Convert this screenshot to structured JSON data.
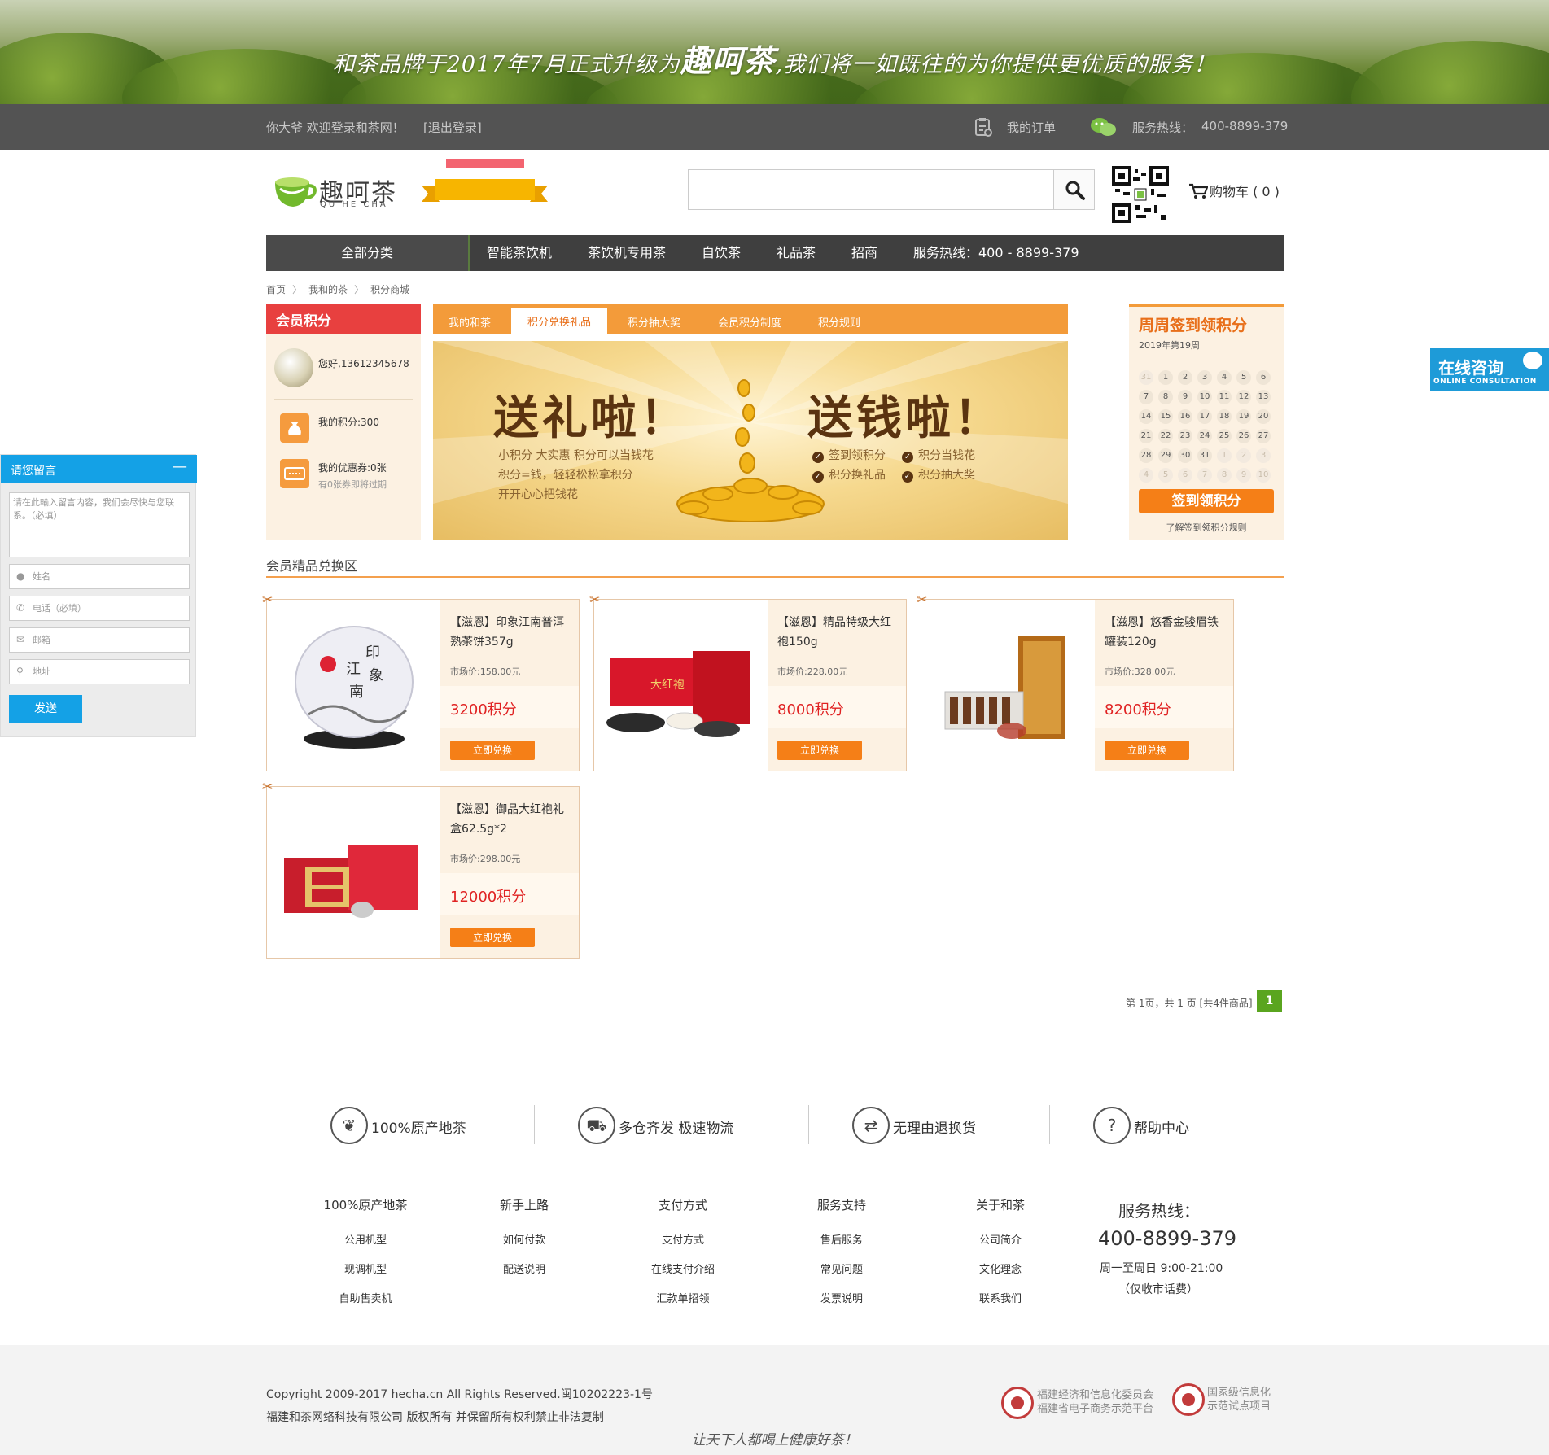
{
  "banner": {
    "text_a": "和茶品牌于2017年7月正式升级为",
    "text_b": "趣呵茶",
    "text_c": ",我们将一如既往的为你提供更优质的服务！"
  },
  "topbar": {
    "welcome": "你大爷 欢迎登录和茶网！",
    "logout": "[退出登录]",
    "orders": "我的订单",
    "hotline_label": "服务热线：",
    "hotline": "400-8899-379"
  },
  "header": {
    "logo_name": "趣呵茶",
    "logo_sub": "QU HE CHA",
    "cart_label": "购物车 ( 0 )"
  },
  "nav": {
    "all": "全部分类",
    "items": [
      "智能茶饮机",
      "茶饮机专用茶",
      "自饮茶",
      "礼品茶",
      "招商",
      "服务热线：400 - 8899-379"
    ]
  },
  "breadcrumb": [
    "首页",
    "我和的茶",
    "积分商城"
  ],
  "member": {
    "title": "会员积分",
    "greeting": "您好,13612345678",
    "points": "我的积分:300",
    "coupons": "我的优惠券:0张",
    "coupons_note": "有0张券即将过期"
  },
  "tabs": [
    "我的和茶",
    "积分兑换礼品",
    "积分抽大奖",
    "会员积分制度",
    "积分规则"
  ],
  "promo": {
    "left_big": "送礼啦！",
    "right_big": "送钱啦！",
    "left_lines": [
      "小积分 大实惠  积分可以当钱花",
      "积分=钱，轻轻松松拿积分",
      "开开心心把钱花"
    ],
    "checks": [
      "签到领积分",
      "积分当钱花",
      "积分换礼品",
      "积分抽大奖"
    ]
  },
  "calendar": {
    "title": "周周签到领积分",
    "week": "2019年第19周",
    "days": [
      "31",
      "1",
      "2",
      "3",
      "4",
      "5",
      "6",
      "7",
      "8",
      "9",
      "10",
      "11",
      "12",
      "13",
      "14",
      "15",
      "16",
      "17",
      "18",
      "19",
      "20",
      "21",
      "22",
      "23",
      "24",
      "25",
      "26",
      "27",
      "28",
      "29",
      "30",
      "31",
      "1",
      "2",
      "3",
      "4",
      "5",
      "6",
      "7",
      "8",
      "9",
      "10"
    ],
    "button": "签到领积分",
    "link": "了解签到领积分规则"
  },
  "section_title": "会员精品兑换区",
  "products": [
    {
      "name": "【滋恩】印象江南普洱熟茶饼357g",
      "market": "市场价:158.00元",
      "points": "3200积分",
      "button": "立即兑换"
    },
    {
      "name": "【滋恩】精品特级大红袍150g",
      "market": "市场价:228.00元",
      "points": "8000积分",
      "button": "立即兑换"
    },
    {
      "name": "【滋恩】悠香金骏眉铁罐装120g",
      "market": "市场价:328.00元",
      "points": "8200积分",
      "button": "立即兑换"
    },
    {
      "name": "【滋恩】御品大红袍礼盒62.5g*2",
      "market": "市场价:298.00元",
      "points": "12000积分",
      "button": "立即兑换"
    }
  ],
  "pager": {
    "text": "第 1页，共 1 页 [共4件商品]",
    "current": "1"
  },
  "message": {
    "title": "请您留言",
    "placeholder": "请在此輸入留言内容，我们会尽快与您联系。（必填）",
    "fields": [
      "姓名",
      "电话（必填）",
      "邮箱",
      "地址"
    ],
    "send": "发送"
  },
  "consult": {
    "title": "在线咨询",
    "sub": "ONLINE CONSULTATION"
  },
  "features": [
    "100%原产地茶",
    "多仓齐发 极速物流",
    "无理由退换货",
    "帮助中心"
  ],
  "footer_cols": [
    {
      "head": "100%原产地茶",
      "links": [
        "公用机型",
        "现调机型",
        "自助售卖机"
      ]
    },
    {
      "head": "新手上路",
      "links": [
        "如何付款",
        "配送说明"
      ]
    },
    {
      "head": "支付方式",
      "links": [
        "支付方式",
        "在线支付介绍",
        "汇款单招领"
      ]
    },
    {
      "head": "服务支持",
      "links": [
        "售后服务",
        "常见问题",
        "发票说明"
      ]
    },
    {
      "head": "关于和茶",
      "links": [
        "公司简介",
        "文化理念",
        "联系我们"
      ]
    }
  ],
  "hotline": {
    "title": "服务热线：",
    "number": "400-8899-379",
    "time": "周一至周日 9:00-21:00",
    "note": "（仅收市话费）"
  },
  "bottom": {
    "copy1": "Copyright 2009-2017 hecha.cn All Rights Reserved.闽10202223-1号",
    "copy2": "福建和茶网络科技有限公司 版权所有 并保留所有权利禁止非法复制",
    "slogan": "让天下人都喝上健康好茶！",
    "seal1_a": "福建经济和信息化委员会",
    "seal1_b": "福建省电子商务示范平台",
    "seal2_a": "国家级信息化",
    "seal2_b": "示范试点项目"
  },
  "colors": {
    "orange": "#f39b3a",
    "accent": "#f57f17",
    "red": "#e8403f",
    "blue": "#14a1e6",
    "green": "#5aa51f",
    "dark": "#3f3f3f"
  }
}
